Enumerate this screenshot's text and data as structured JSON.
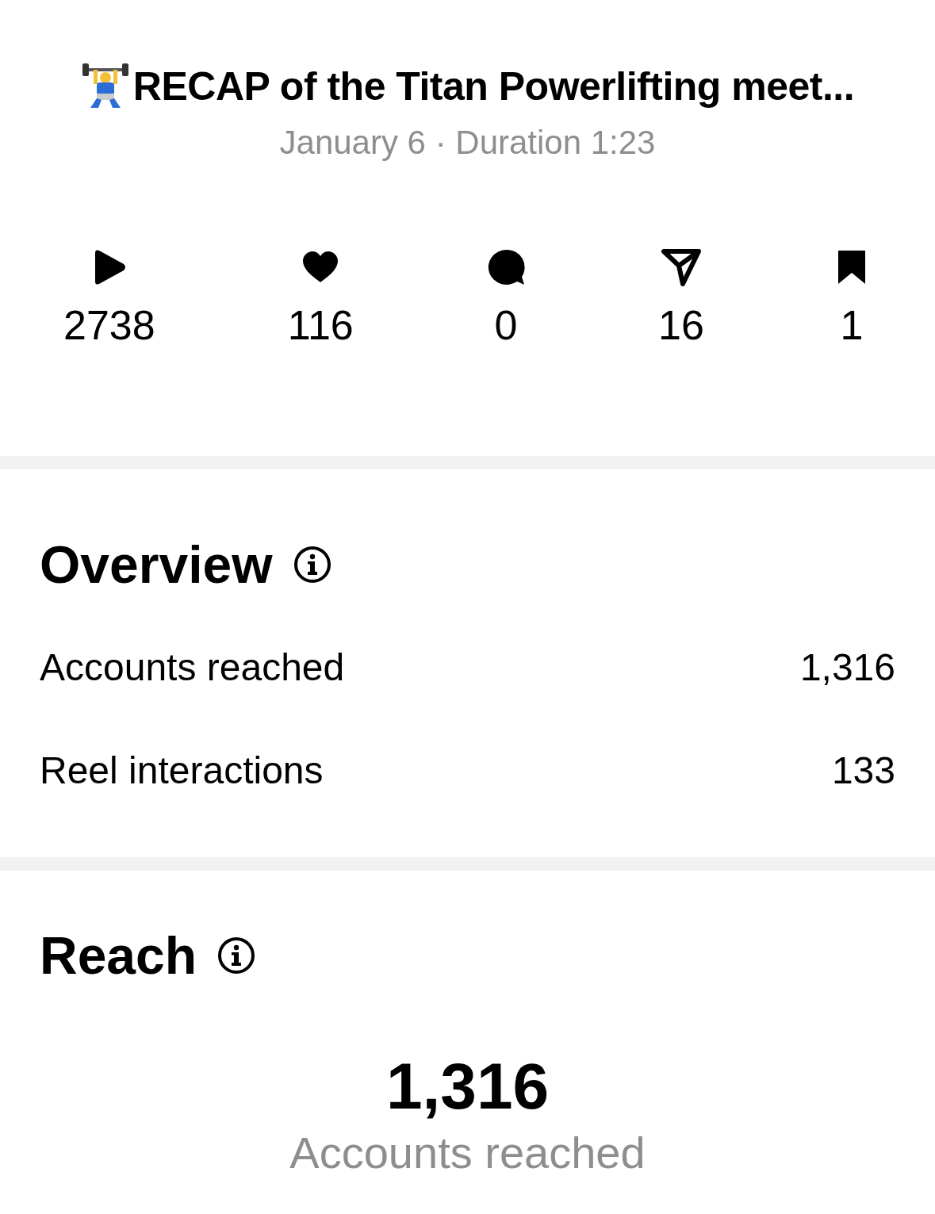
{
  "post": {
    "title": "RECAP of the Titan Powerlifting meet...",
    "subtitle": "January 6 · Duration 1:23"
  },
  "stats": [
    {
      "kind": "plays",
      "value": "2738"
    },
    {
      "kind": "likes",
      "value": "116"
    },
    {
      "kind": "comments",
      "value": "0"
    },
    {
      "kind": "shares",
      "value": "16"
    },
    {
      "kind": "saves",
      "value": "1"
    }
  ],
  "overview": {
    "title": "Overview",
    "rows": [
      {
        "label": "Accounts reached",
        "value": "1,316"
      },
      {
        "label": "Reel interactions",
        "value": "133"
      }
    ]
  },
  "reach": {
    "title": "Reach",
    "value": "1,316",
    "caption": "Accounts reached"
  }
}
